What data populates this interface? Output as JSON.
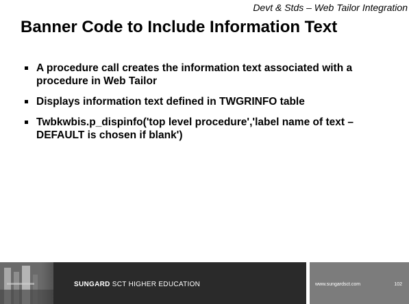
{
  "header": {
    "tag": "Devt & Stds – Web Tailor Integration"
  },
  "slide": {
    "title": "Banner Code to Include Information Text",
    "bullets": [
      "A procedure call creates the information text associated with a procedure in Web Tailor",
      "Displays information text defined in TWGRINFO table",
      "Twbkwbis.p_dispinfo('top level procedure','label name of text – DEFAULT is chosen if blank')"
    ]
  },
  "footer": {
    "brand_strong": "SUNGARD",
    "brand_rest": "SCT HIGHER EDUCATION",
    "url": "www.sungardsct.com",
    "page_number": "102",
    "colors": {
      "dark_band": "#2a2a2a",
      "gray_band": "#7c7c7c"
    }
  }
}
